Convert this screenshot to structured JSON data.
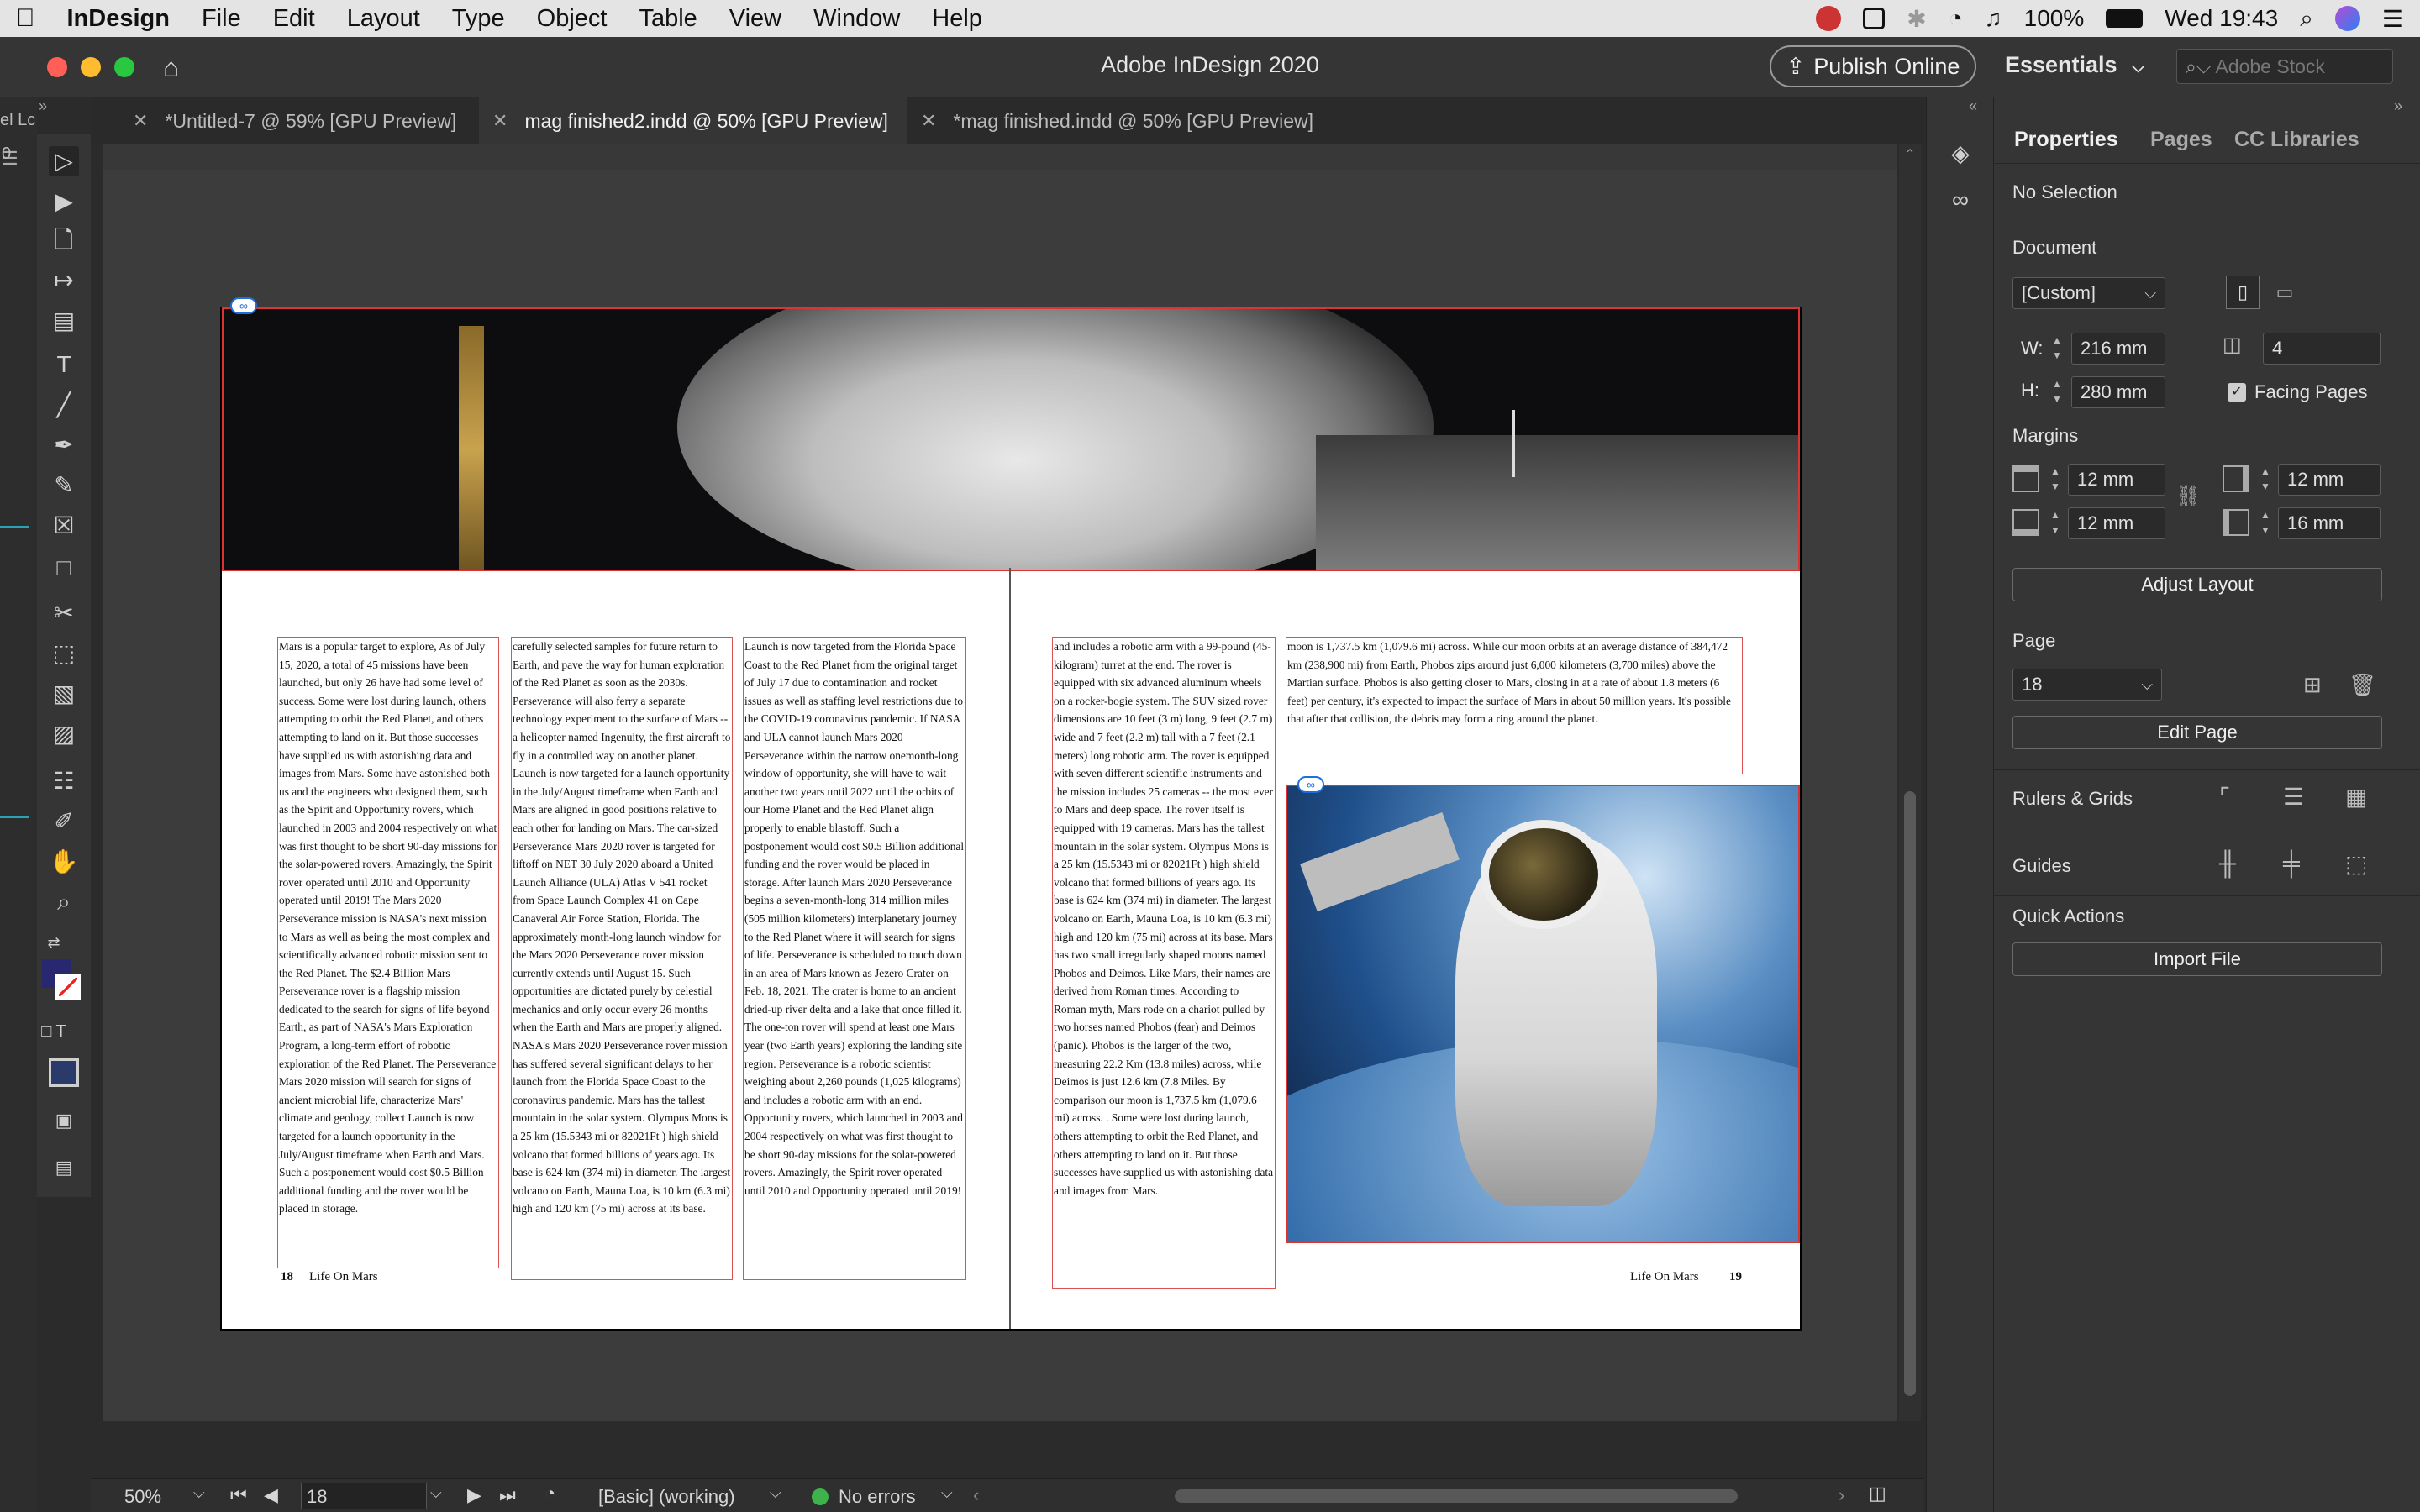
{
  "menubar": {
    "apple": "",
    "app": "InDesign",
    "items": [
      "File",
      "Edit",
      "Layout",
      "Type",
      "Object",
      "Table",
      "View",
      "Window",
      "Help"
    ],
    "battery": "100%",
    "clock": "Wed 19:43"
  },
  "window": {
    "title": "Adobe InDesign 2020",
    "publish_label": "Publish Online",
    "workspace_label": "Essentials",
    "stock_placeholder": "Adobe Stock"
  },
  "tabs": [
    {
      "label": "*Untitled-7 @ 59% [GPU Preview]",
      "active": false
    },
    {
      "label": "mag finished2.indd @ 50% [GPU Preview]",
      "active": true
    },
    {
      "label": "*mag finished.indd @ 50% [GPU Preview]",
      "active": false
    }
  ],
  "document": {
    "col1": "Mars is a popular target to explore, As of July 15, 2020, a total of 45 missions have been launched, but only 26 have had some level of success. Some were lost during launch, others attempting to orbit the Red Planet, and others attempting to land on it. But those successes have supplied us with astonishing data and images from Mars. Some have astonished both us and the engineers who designed them, such as the Spirit and Opportunity rovers, which launched in 2003 and 2004 respectively on what was first thought to be short 90-day missions for the solar-powered rovers. Amazingly, the Spirit rover operated until 2010 and Opportunity operated until 2019! The Mars 2020 Perseverance mission is NASA's next mission to Mars as well as being the most complex and scientifically advanced robotic mission sent to the Red Planet. The $2.4 Billion Mars Perseverance rover is a flagship mission dedicated to the search for signs of life beyond Earth, as part of NASA's Mars Exploration Program, a long-term effort of robotic exploration of the Red Planet. The Perseverance Mars 2020 mission will search for signs of ancient microbial life, characterize Mars' climate and geology, collect Launch is now targeted for a launch opportunity in the July/August timeframe when Earth and Mars. Such a postponement would cost $0.5 Billion additional funding and the rover would be placed in storage.",
    "col2": "carefully selected samples for future return to Earth, and pave the way for human exploration of the Red Planet as soon as the 2030s. Perseverance will also ferry a separate technology experiment to the surface of Mars -- a helicopter named Ingenuity, the first aircraft to fly in a controlled way on another planet. Launch is now targeted for a launch opportunity in the July/August timeframe when Earth and Mars are aligned in good positions relative to each other for landing on Mars. The car-sized Perseverance Mars 2020 rover is targeted for liftoff on NET 30 July 2020 aboard a United Launch Alliance (ULA) Atlas V 541 rocket from Space Launch Complex 41 on Cape Canaveral Air Force Station, Florida. The approximately month-long launch window for the Mars 2020 Perseverance rover mission currently extends until August 15. Such opportunities are dictated purely by celestial mechanics and only occur every 26 months when the Earth and Mars are properly aligned. NASA's Mars 2020 Perseverance rover mission has suffered several significant delays to her launch from the Florida Space Coast to the coronavirus pandemic. Mars has the tallest mountain in the solar system. Olympus Mons is a 25 km (15.5343 mi or 82021Ft ) high shield volcano that formed billions of years ago. Its base is 624 km (374 mi) in diameter. The largest volcano on Earth, Mauna Loa, is 10 km (6.3 mi) high and 120 km (75 mi) across at its base.",
    "col3": "Launch is now targeted from the Florida Space Coast to the Red Planet from the original target of July 17 due to contamination and rocket issues as well as staffing level restrictions due to the COVID-19 coronavirus pandemic. If NASA and ULA cannot launch Mars 2020 Perseverance within the narrow onemonth-long window of opportunity, she will have to wait another two years until 2022 until the orbits of our Home Planet and the Red Planet align properly to enable blastoff. Such a postponement would cost $0.5 Billion additional funding and the rover would be placed in storage. After launch Mars 2020 Perseverance begins a seven-month-long 314 million miles (505 million kilometers) interplanetary journey to the Red Planet where it will search for signs of life. Perseverance is scheduled to touch down in an area of Mars known as Jezero Crater on Feb. 18, 2021. The crater is home to an ancient dried-up river delta and a lake that once filled it. The one-ton rover will spend at least one Mars year (two Earth years) exploring the landing site region. Perseverance is a robotic scientist weighing about 2,260 pounds (1,025 kilograms) and includes a robotic arm with an end. Opportunity rovers, which launched in 2003 and 2004 respectively on what was first thought to be short 90-day missions for the solar-powered rovers. Amazingly, the Spirit rover operated until 2010 and Opportunity operated until 2019!",
    "col4": "and includes a robotic arm with a 99-pound (45-kilogram) turret at the end. The rover is equipped with six advanced aluminum wheels on a rocker-bogie system. The SUV sized rover dimensions are 10 feet (3 m) long, 9 feet (2.7 m) wide and 7 feet (2.2 m) tall with a 7 feet (2.1 meters) long robotic arm. The rover is equipped with seven different scientific instruments and the mission includes 25 cameras -- the most ever to Mars and deep space. The rover itself is equipped with 19 cameras. Mars has the tallest mountain in the solar system. Olympus Mons is a 25 km (15.5343 mi or 82021Ft ) high shield volcano that formed billions of years ago. Its base is 624 km (374 mi) in diameter. The largest volcano on Earth, Mauna Loa, is 10 km (6.3 mi) high and 120 km (75 mi) across at its base. Mars has two small irregularly shaped moons named Phobos and Deimos. Like Mars, their names are derived from Roman times. According to Roman myth, Mars rode on a chariot pulled by two horses named Phobos (fear) and Deimos (panic). Phobos is the larger of the two, measuring 22.2 Km (13.8 miles) across, while Deimos is just 12.6 km (7.8 Miles. By comparison our moon is 1,737.5 km (1,079.6 mi) across. . Some were lost during launch, others attempting to orbit the Red Planet, and others attempting to land on it. But those successes have supplied us with astonishing data and images from Mars.",
    "col5": "moon is 1,737.5 km (1,079.6 mi) across. While our moon orbits at an average distance of 384,472 km (238,900 mi) from Earth, Phobos zips around just 6,000 kilometers (3,700 miles) above the Martian surface. Phobos is also getting closer to Mars, closing in at a rate of about 1.8 meters (6 feet) per century, it's expected to impact the surface of Mars in about 50 million years. It's possible that after that collision, the debris may form a ring around the planet.",
    "footer_left_num": "18",
    "footer_left_text": "Life On Mars",
    "footer_right_text": "Life On Mars",
    "footer_right_num": "19"
  },
  "statusbar": {
    "zoom": "50%",
    "page": "18",
    "profile": "[Basic] (working)",
    "preflight": "No errors",
    "preflight_color": "#3cb44b"
  },
  "properties": {
    "tabs": [
      "Properties",
      "Pages",
      "CC Libraries"
    ],
    "selection": "No Selection",
    "document_label": "Document",
    "preset": "[Custom]",
    "w_label": "W:",
    "w_value": "216 mm",
    "h_label": "H:",
    "h_value": "280 mm",
    "pages_value": "4",
    "facing_label": "Facing Pages",
    "facing_checked": true,
    "margins_label": "Margins",
    "margin_top": "12 mm",
    "margin_bottom": "12 mm",
    "margin_inside": "12 mm",
    "margin_outside": "16 mm",
    "adjust_layout": "Adjust Layout",
    "page_label": "Page",
    "page_value": "18",
    "edit_page": "Edit Page",
    "rulers_label": "Rulers & Grids",
    "guides_label": "Guides",
    "quick_actions_label": "Quick Actions",
    "import_file": "Import File"
  },
  "left_edge": {
    "ruler_text": "el Lc",
    "ruler_num": "0"
  }
}
